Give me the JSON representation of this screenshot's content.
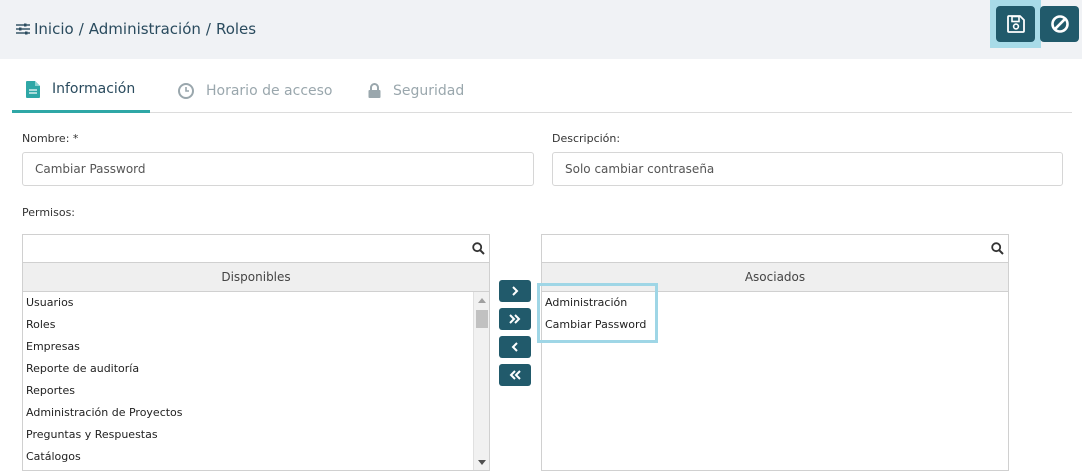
{
  "breadcrumb": {
    "items": [
      "Inicio",
      "Administración",
      "Roles"
    ],
    "separator": "/"
  },
  "toolbar": {
    "save_icon": "floppy-disk-icon",
    "cancel_icon": "ban-icon"
  },
  "tabs": [
    {
      "label": "Información",
      "icon": "document-icon",
      "active": true
    },
    {
      "label": "Horario de acceso",
      "icon": "clock-icon",
      "active": false
    },
    {
      "label": "Seguridad",
      "icon": "lock-icon",
      "active": false
    }
  ],
  "form": {
    "nombre": {
      "label": "Nombre: *",
      "value": "Cambiar Password"
    },
    "descripcion": {
      "label": "Descripción:",
      "value": "Solo cambiar contraseña"
    },
    "permisos_label": "Permisos:"
  },
  "disponibles": {
    "header": "Disponibles",
    "search_value": "",
    "items": [
      "Usuarios",
      "Roles",
      "Empresas",
      "Reporte de auditoría",
      "Reportes",
      "Administración de Proyectos",
      "Preguntas y Respuestas",
      "Catálogos"
    ]
  },
  "asociados": {
    "header": "Asociados",
    "search_value": "",
    "items": [
      "Administración",
      "Cambiar Password"
    ]
  },
  "transfer_buttons": [
    {
      "icon": "chevron-right-icon",
      "glyph": "›"
    },
    {
      "icon": "double-chevron-right-icon",
      "glyph": "»"
    },
    {
      "icon": "chevron-left-icon",
      "glyph": "‹"
    },
    {
      "icon": "double-chevron-left-icon",
      "glyph": "«"
    }
  ],
  "colors": {
    "primary": "#215a6b",
    "accent": "#2fa7a6",
    "highlight": "#a8dbe8",
    "header_bg": "#f0f2f5"
  }
}
